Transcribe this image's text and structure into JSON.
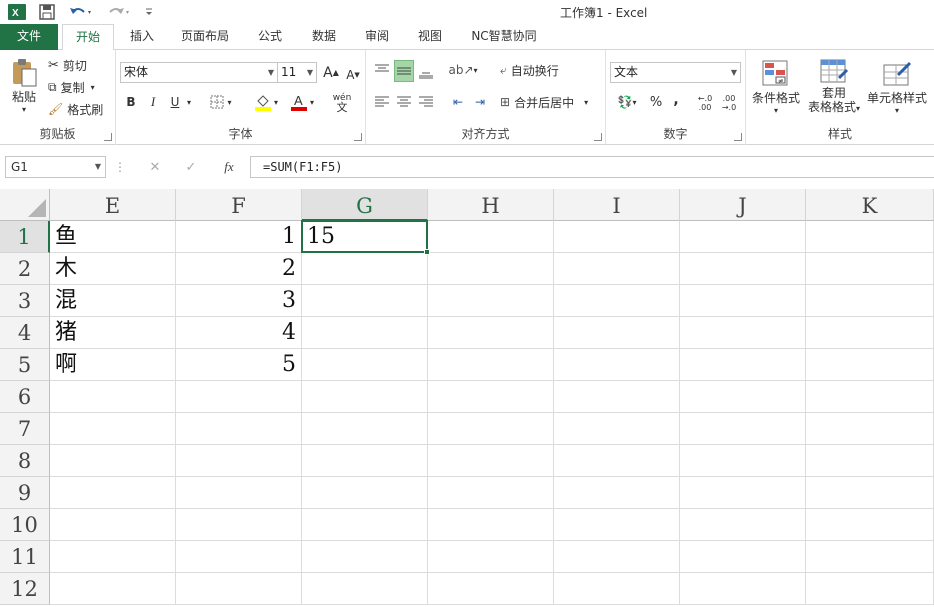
{
  "titlebar": {
    "title": "工作簿1 - Excel",
    "undo_icon": "undo-icon",
    "redo_icon": "redo-icon",
    "save_icon": "save-icon"
  },
  "tabs": [
    "文件",
    "开始",
    "插入",
    "页面布局",
    "公式",
    "数据",
    "审阅",
    "视图",
    "NC智慧协同"
  ],
  "ribbon": {
    "clipboard": {
      "label": "剪贴板",
      "paste": "粘贴",
      "cut": "剪切",
      "copy": "复制",
      "format_painter": "格式刷"
    },
    "font": {
      "label": "字体",
      "font_name": "宋体",
      "font_size": "11",
      "bold": "B",
      "italic": "I",
      "underline": "U",
      "grow": "A",
      "shrink": "A",
      "wen": "wén",
      "wen_sub": "文"
    },
    "alignment": {
      "label": "对齐方式",
      "wrap_text": "自动换行",
      "merge_center": "合并后居中"
    },
    "number": {
      "label": "数字",
      "format": "文本",
      "percent": "%",
      "comma": ",",
      "inc_decimal": "←.0\n.00",
      "dec_decimal": ".00\n→.0"
    },
    "styles": {
      "label": "样式",
      "conditional": "条件格式",
      "table_line1": "套用",
      "table_line2": "表格格式",
      "cell_styles": "单元格样式"
    }
  },
  "formula_bar": {
    "name_box": "G1",
    "cancel": "✕",
    "enter": "✓",
    "fx": "fx",
    "formula": "=SUM(F1:F5)"
  },
  "grid": {
    "columns": [
      "E",
      "F",
      "G",
      "H",
      "I",
      "J",
      "K"
    ],
    "rows": [
      "1",
      "2",
      "3",
      "4",
      "5",
      "6",
      "7",
      "8",
      "9",
      "10",
      "11",
      "12"
    ],
    "cells": {
      "E1": "鱼",
      "E2": "木",
      "E3": "混",
      "E4": "猪",
      "E5": "啊",
      "F1": "1",
      "F2": "2",
      "F3": "3",
      "F4": "4",
      "F5": "5",
      "G1": "15"
    },
    "selected": "G1"
  },
  "colors": {
    "accent": "#217346",
    "header_bg": "#f3f3f3"
  }
}
